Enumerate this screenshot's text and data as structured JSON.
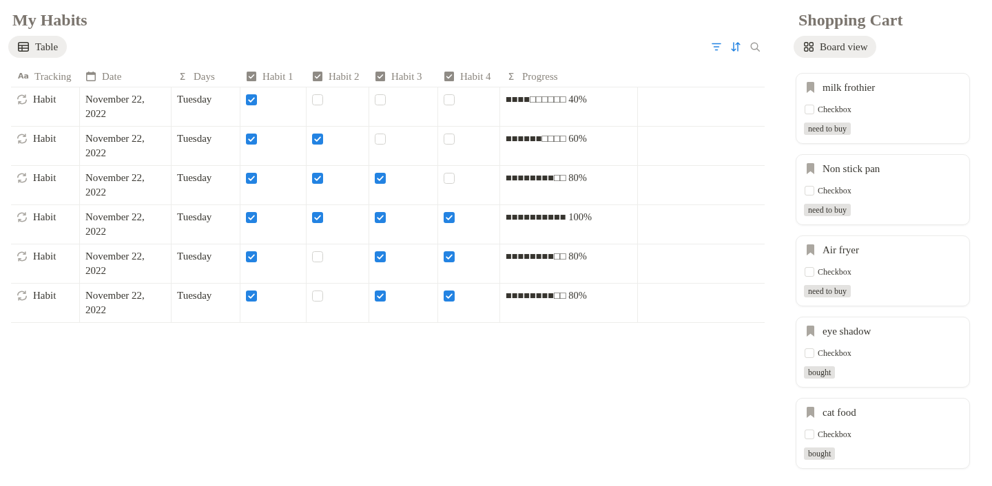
{
  "habits": {
    "title": "My Habits",
    "view_tab": {
      "label": "Table",
      "selected": true
    },
    "toolbar": {
      "filter_active": true,
      "sort_active": true
    },
    "columns": [
      {
        "label": "Tracking",
        "kind": "title",
        "glyph": "Aa"
      },
      {
        "label": "Date",
        "kind": "date"
      },
      {
        "label": "Days",
        "kind": "formula",
        "glyph": "Σ"
      },
      {
        "label": "Habit 1",
        "kind": "checkbox"
      },
      {
        "label": "Habit 2",
        "kind": "checkbox"
      },
      {
        "label": "Habit 3",
        "kind": "checkbox"
      },
      {
        "label": "Habit 4",
        "kind": "checkbox"
      },
      {
        "label": "Progress",
        "kind": "formula",
        "glyph": "Σ"
      }
    ],
    "rows": [
      {
        "tracking": "Habit",
        "date": "November 22, 2022",
        "days": "Tuesday",
        "habits": [
          {
            "checked": true
          },
          {
            "checked": false
          },
          {
            "checked": false
          },
          {
            "checked": false
          }
        ],
        "progress": "■■■■□□□□□□ 40%"
      },
      {
        "tracking": "Habit",
        "date": "November 22, 2022",
        "days": "Tuesday",
        "habits": [
          {
            "checked": true
          },
          {
            "checked": true
          },
          {
            "checked": false
          },
          {
            "checked": false
          }
        ],
        "progress": "■■■■■■□□□□ 60%"
      },
      {
        "tracking": "Habit",
        "date": "November 22, 2022",
        "days": "Tuesday",
        "habits": [
          {
            "checked": true
          },
          {
            "checked": true
          },
          {
            "checked": true
          },
          {
            "checked": false
          }
        ],
        "progress": "■■■■■■■■□□ 80%"
      },
      {
        "tracking": "Habit",
        "date": "November 22, 2022",
        "days": "Tuesday",
        "habits": [
          {
            "checked": true
          },
          {
            "checked": true
          },
          {
            "checked": true
          },
          {
            "checked": true
          }
        ],
        "progress": "■■■■■■■■■■ 100%"
      },
      {
        "tracking": "Habit",
        "date": "November 22, 2022",
        "days": "Tuesday",
        "habits": [
          {
            "checked": true
          },
          {
            "checked": false
          },
          {
            "checked": true
          },
          {
            "checked": true
          }
        ],
        "progress": "■■■■■■■■□□ 80%"
      },
      {
        "tracking": "Habit",
        "date": "November 22, 2022",
        "days": "Tuesday",
        "habits": [
          {
            "checked": true
          },
          {
            "checked": false
          },
          {
            "checked": true
          },
          {
            "checked": true
          }
        ],
        "progress": "■■■■■■■■□□ 80%"
      }
    ]
  },
  "shopping_cart": {
    "title": "Shopping Cart",
    "view_tab": {
      "label": "Board view",
      "selected": true
    },
    "cards": [
      {
        "name": "milk frothier",
        "checkbox": {
          "label": "Checkbox",
          "checked": false
        },
        "tag": "need to buy"
      },
      {
        "name": "Non stick pan",
        "checkbox": {
          "label": "Checkbox",
          "checked": false
        },
        "tag": "need to buy"
      },
      {
        "name": "Air fryer",
        "checkbox": {
          "label": "Checkbox",
          "checked": false
        },
        "tag": "need to buy"
      },
      {
        "name": "eye shadow",
        "checkbox": {
          "label": "Checkbox",
          "checked": false
        },
        "tag": "bought"
      },
      {
        "name": "cat food",
        "checkbox": {
          "label": "Checkbox",
          "checked": false
        },
        "tag": "bought"
      }
    ]
  }
}
